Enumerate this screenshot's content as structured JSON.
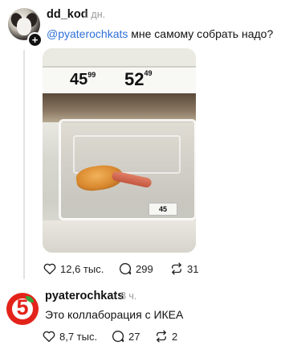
{
  "post": {
    "username": "dd_kod",
    "time": "1 дн.",
    "mention": "@pyaterochkats",
    "text": " мне самому собрать надо?",
    "photo": {
      "price_left": "45",
      "price_left_cents": "99",
      "price_right": "52",
      "price_right_cents": "49",
      "tag_price": "45"
    },
    "likes": "12,6 тыс.",
    "comments": "299",
    "reposts": "31"
  },
  "reply": {
    "username": "pyaterochkats",
    "time": "8 ч.",
    "text": "Это коллаборация с ИКЕА",
    "avatar_glyph": "5",
    "likes": "8,7 тыс.",
    "comments": "27",
    "reposts": "2"
  },
  "icons": {
    "like": "heart-icon",
    "comment": "comment-bubble-icon",
    "repost": "repost-arrows-icon",
    "follow": "plus-icon"
  },
  "colors": {
    "mention": "#2f6fd8",
    "brand_red": "#e3231a",
    "brand_green": "#37a33c",
    "muted": "#9b9b9b"
  }
}
